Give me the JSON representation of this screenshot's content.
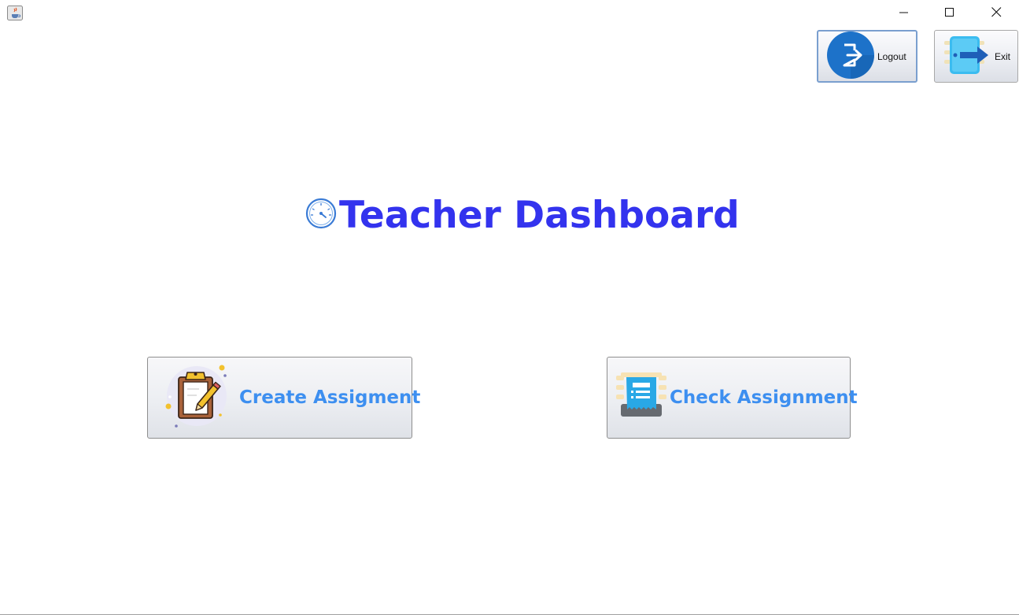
{
  "window": {
    "app_icon": "java-cup-icon",
    "controls": {
      "minimize_icon": "minimize-icon",
      "maximize_icon": "maximize-icon",
      "close_icon": "close-icon"
    }
  },
  "toolbar": {
    "logout_label": "Logout",
    "logout_icon": "logout-icon",
    "exit_label": "Exit",
    "exit_icon": "exit-door-icon"
  },
  "heading": {
    "icon": "speedometer-icon",
    "title": "Teacher Dashboard",
    "color": "#3333ee"
  },
  "actions": {
    "create_label": "Create Assigment",
    "create_icon": "clipboard-pencil-icon",
    "check_label": "Check Assignment",
    "check_icon": "document-check-icon",
    "label_color": "#3d8ff0"
  }
}
